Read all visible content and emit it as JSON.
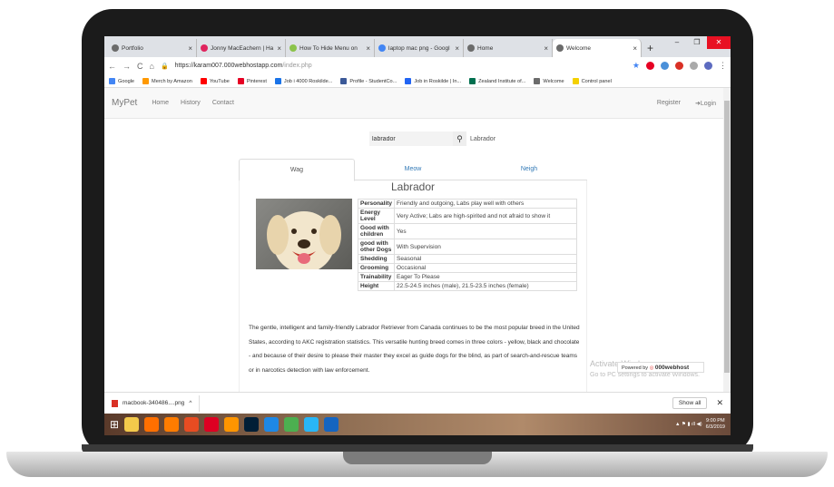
{
  "browser": {
    "tabs": [
      {
        "title": "Portfolio",
        "color": "#6b6b6b"
      },
      {
        "title": "Jonny MacEachern | Ha",
        "color": "#e0245e"
      },
      {
        "title": "How To Hide Menu on",
        "color": "#8bc34a"
      },
      {
        "title": "laptop mac png - Googl",
        "color": "#4285f4"
      },
      {
        "title": "Home",
        "color": "#6b6b6b"
      },
      {
        "title": "Welcome",
        "color": "#6b6b6b",
        "active": true
      }
    ],
    "url_host": "https://karam007.000webhostapp.com",
    "url_path": "/index.php",
    "bookmarks": [
      {
        "label": "Google",
        "color": "#4285f4"
      },
      {
        "label": "Merch by Amazon",
        "color": "#ff9900"
      },
      {
        "label": "YouTube",
        "color": "#ff0000"
      },
      {
        "label": "Pinterest",
        "color": "#e60023"
      },
      {
        "label": "Job i 4000 Roskilde...",
        "color": "#1a73e8"
      },
      {
        "label": "Profile - StudentCo...",
        "color": "#3b5998"
      },
      {
        "label": "Job in Roskilde | In...",
        "color": "#2164f3"
      },
      {
        "label": "Zealand Institute of...",
        "color": "#006f4f"
      },
      {
        "label": "Welcome",
        "color": "#6b6b6b"
      },
      {
        "label": "Control panel",
        "color": "#f4d000"
      }
    ]
  },
  "nav": {
    "brand": "MyPet",
    "links": [
      "Home",
      "History",
      "Contact"
    ],
    "register": "Register",
    "login": "Login"
  },
  "search": {
    "value": "labrador",
    "result": "Labrador"
  },
  "tabs": [
    "Wag",
    "Meow",
    "Neigh"
  ],
  "breed": {
    "name": "Labrador",
    "traits": [
      {
        "k": "Personality",
        "v": "Friendly and outgoing, Labs play well with others"
      },
      {
        "k": "Energy Level",
        "v": "Very Active; Labs are high-spirited and not afraid to show it"
      },
      {
        "k": "Good with children",
        "v": "Yes"
      },
      {
        "k": "good with other Dogs",
        "v": "With Supervision"
      },
      {
        "k": "Shedding",
        "v": "Seasonal"
      },
      {
        "k": "Grooming",
        "v": "Occasional"
      },
      {
        "k": "Trainability",
        "v": "Eager To Please"
      },
      {
        "k": "Height",
        "v": "22.5-24.5 inches (male), 21.5-23.5 inches (female)"
      }
    ],
    "description": "The gentle, intelligent and family-friendly Labrador Retriever from Canada continues to be the most popular breed in the United States, according to AKC registration statistics. This versatile hunting breed comes in three colors - yellow, black and chocolate - and because of their desire to please their master they excel as guide dogs for the blind, as part of search-and-rescue teams or in narcotics detection with law enforcement."
  },
  "watermark": {
    "title": "Activate Windows",
    "sub": "Go to PC settings to activate Windows.",
    "powered": "Powered by",
    "host": "000webhost"
  },
  "download": {
    "file": "macbook-340486....png",
    "show_all": "Show all"
  },
  "taskbar": {
    "time": "9:00 PM",
    "date": "6/3/2019"
  }
}
